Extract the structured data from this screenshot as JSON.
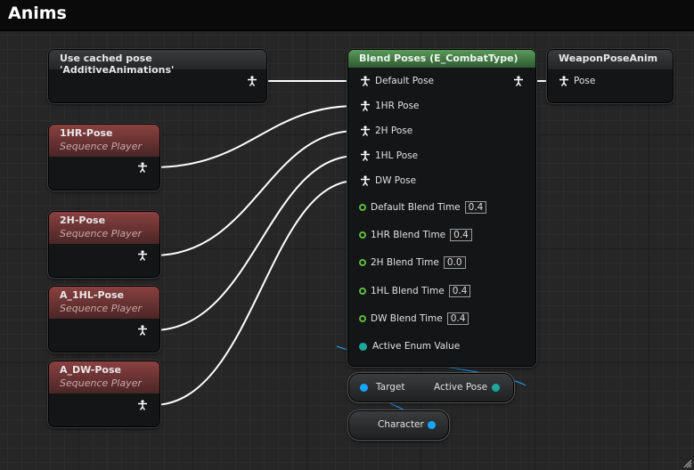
{
  "window": {
    "title": "Anims"
  },
  "nodes": {
    "cached_pose": {
      "title": "Use cached pose 'AdditiveAnimations'"
    },
    "seq_1hr": {
      "title": "1HR-Pose",
      "subtitle": "Sequence Player"
    },
    "seq_2h": {
      "title": "2H-Pose",
      "subtitle": "Sequence Player"
    },
    "seq_1hl": {
      "title": "A_1HL-Pose",
      "subtitle": "Sequence Player"
    },
    "seq_dw": {
      "title": "A_DW-Pose",
      "subtitle": "Sequence Player"
    },
    "blend": {
      "title": "Blend Poses (E_CombatType)",
      "pose_pins": [
        "Default Pose",
        "1HR Pose",
        "2H Pose",
        "1HL Pose",
        "DW Pose"
      ],
      "blend_times": [
        {
          "label": "Default Blend Time",
          "value": "0.4"
        },
        {
          "label": "1HR Blend Time",
          "value": "0.4"
        },
        {
          "label": "2H Blend Time",
          "value": "0.0"
        },
        {
          "label": "1HL Blend Time",
          "value": "0.4"
        },
        {
          "label": "DW Blend Time",
          "value": "0.4"
        }
      ],
      "enum_pin": "Active Enum Value"
    },
    "weapon": {
      "title": "WeaponPoseAnim",
      "pin": "Pose"
    },
    "get_active_pose": {
      "target": "Target",
      "output": "Active Pose"
    },
    "character": {
      "label": "Character"
    }
  },
  "colors": {
    "pose_wire": "#ffffff",
    "exec_pin": "#5fbb3a",
    "enum_pin": "#1aa7a0",
    "object_pin": "#15a7ff"
  },
  "icons": {
    "pose": "pose-figure-icon",
    "float": "float-ring-icon",
    "enum": "enum-dot-icon",
    "object": "object-dot-icon",
    "resize": "resize-grip-icon"
  }
}
